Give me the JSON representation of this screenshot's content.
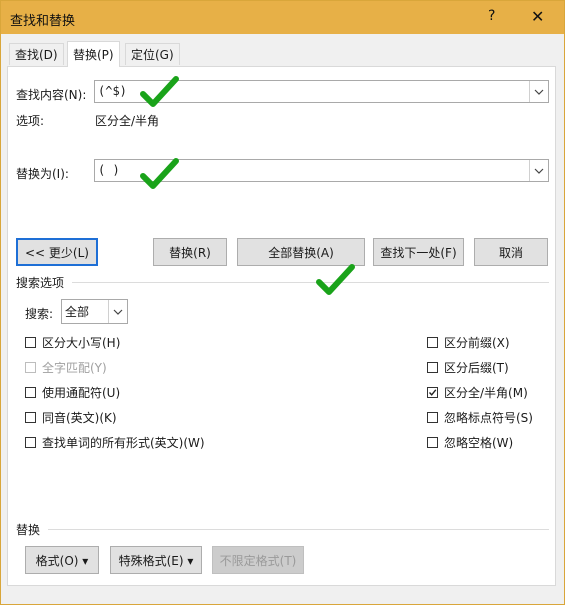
{
  "window": {
    "title": "查找和替换",
    "help": "?",
    "close": "✕"
  },
  "tabs": [
    {
      "label": "查找(D)"
    },
    {
      "label": "替换(P)"
    },
    {
      "label": "定位(G)"
    }
  ],
  "find": {
    "label": "查找内容(N):",
    "value": "(^$)"
  },
  "options_row": {
    "label": "选项:",
    "value": "区分全/半角"
  },
  "replace": {
    "label": "替换为(I):",
    "value": "( )"
  },
  "buttons": {
    "less": "<< 更少(L)",
    "replace": "替换(R)",
    "replace_all": "全部替换(A)",
    "find_next": "查找下一处(F)",
    "cancel": "取消"
  },
  "search_options": {
    "title": "搜索选项",
    "search_label": "搜索:",
    "search_value": "全部",
    "left": [
      {
        "label": "区分大小写(H)",
        "checked": false,
        "disabled": false
      },
      {
        "label": "全字匹配(Y)",
        "checked": false,
        "disabled": true
      },
      {
        "label": "使用通配符(U)",
        "checked": false,
        "disabled": false
      },
      {
        "label": "同音(英文)(K)",
        "checked": false,
        "disabled": false
      },
      {
        "label": "查找单词的所有形式(英文)(W)",
        "checked": false,
        "disabled": false
      }
    ],
    "right": [
      {
        "label": "区分前缀(X)",
        "checked": false,
        "disabled": false
      },
      {
        "label": "区分后缀(T)",
        "checked": false,
        "disabled": false
      },
      {
        "label": "区分全/半角(M)",
        "checked": true,
        "disabled": false
      },
      {
        "label": "忽略标点符号(S)",
        "checked": false,
        "disabled": false
      },
      {
        "label": "忽略空格(W)",
        "checked": false,
        "disabled": false
      }
    ]
  },
  "replace_section": {
    "title": "替换",
    "format": "格式(O) ▾",
    "special": "特殊格式(E) ▾",
    "no_format": "不限定格式(T)"
  },
  "colors": {
    "titlebar": "#e7b047",
    "check_mark": "#1aa31a",
    "focus": "#1e6fd6"
  }
}
